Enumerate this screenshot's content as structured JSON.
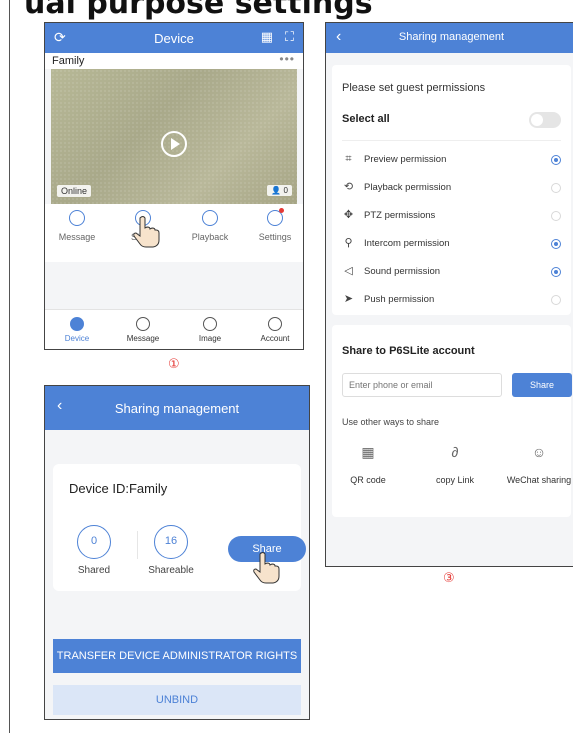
{
  "heading": "ual purpose settings",
  "screen1": {
    "title": "Device",
    "camera_name": "Family",
    "more": "•••",
    "status": "Online",
    "viewer_count": "0",
    "actions": [
      {
        "label": "Message"
      },
      {
        "label": "Share"
      },
      {
        "label": "Playback"
      },
      {
        "label": "Settings"
      }
    ],
    "tabs": [
      {
        "label": "Device"
      },
      {
        "label": "Message"
      },
      {
        "label": "Image"
      },
      {
        "label": "Account"
      }
    ],
    "step": "①"
  },
  "screen2": {
    "title": "Sharing management",
    "device_id": "Device ID:Family",
    "shared_count": "0",
    "shared_label": "Shared",
    "shareable_count": "16",
    "shareable_label": "Shareable",
    "share_button": "Share",
    "transfer_button": "TRANSFER DEVICE ADMINISTRATOR RIGHTS",
    "unbind_button": "UNBIND"
  },
  "screen3": {
    "title": "Sharing management",
    "permissions_title": "Please set guest permissions",
    "select_all": "Select all",
    "select_all_on": false,
    "permissions": [
      {
        "label": "Preview permission",
        "icon": "⌗",
        "checked": true
      },
      {
        "label": "Playback permission",
        "icon": "⟲",
        "checked": false
      },
      {
        "label": "PTZ permissions",
        "icon": "✥",
        "checked": false
      },
      {
        "label": "Intercom permission",
        "icon": "⚲",
        "checked": true
      },
      {
        "label": "Sound permission",
        "icon": "◁",
        "checked": true
      },
      {
        "label": "Push permission",
        "icon": "➤",
        "checked": false
      }
    ],
    "share_to_title": "Share to P6SLite account",
    "input_placeholder": "Enter phone or email",
    "share_button": "Share",
    "other_ways": "Use other ways to share",
    "ways": [
      {
        "label": "QR code",
        "icon": "▦"
      },
      {
        "label": "copy Link",
        "icon": "∂"
      },
      {
        "label": "WeChat sharing",
        "icon": "☺"
      }
    ],
    "step": "③"
  },
  "colors": {
    "accent": "#4d82d6",
    "step_marker": "#e53935"
  }
}
